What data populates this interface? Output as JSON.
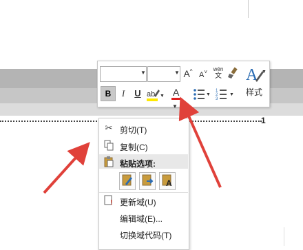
{
  "toolbar": {
    "grow_font": "A",
    "shrink_font": "A",
    "phonetic_top": "wén",
    "phonetic_bottom": "文",
    "bold": "B",
    "italic": "I",
    "underline": "U",
    "font_color": "A",
    "styles_label": "样式"
  },
  "document": {
    "field_number": "1"
  },
  "menu": {
    "cut": "剪切(T)",
    "copy": "复制(C)",
    "paste_options": "粘贴选项:",
    "update_field": "更新域(U)",
    "edit_field": "编辑域(E)...",
    "toggle_field_codes": "切换域代码(T)"
  },
  "colors": {
    "arrow": "#e0413a",
    "highlight": "#ffe900",
    "font_color_bar": "#e02020"
  },
  "icons": [
    "scissors-icon",
    "copy-icon",
    "paste-icon",
    "update-field-icon"
  ]
}
